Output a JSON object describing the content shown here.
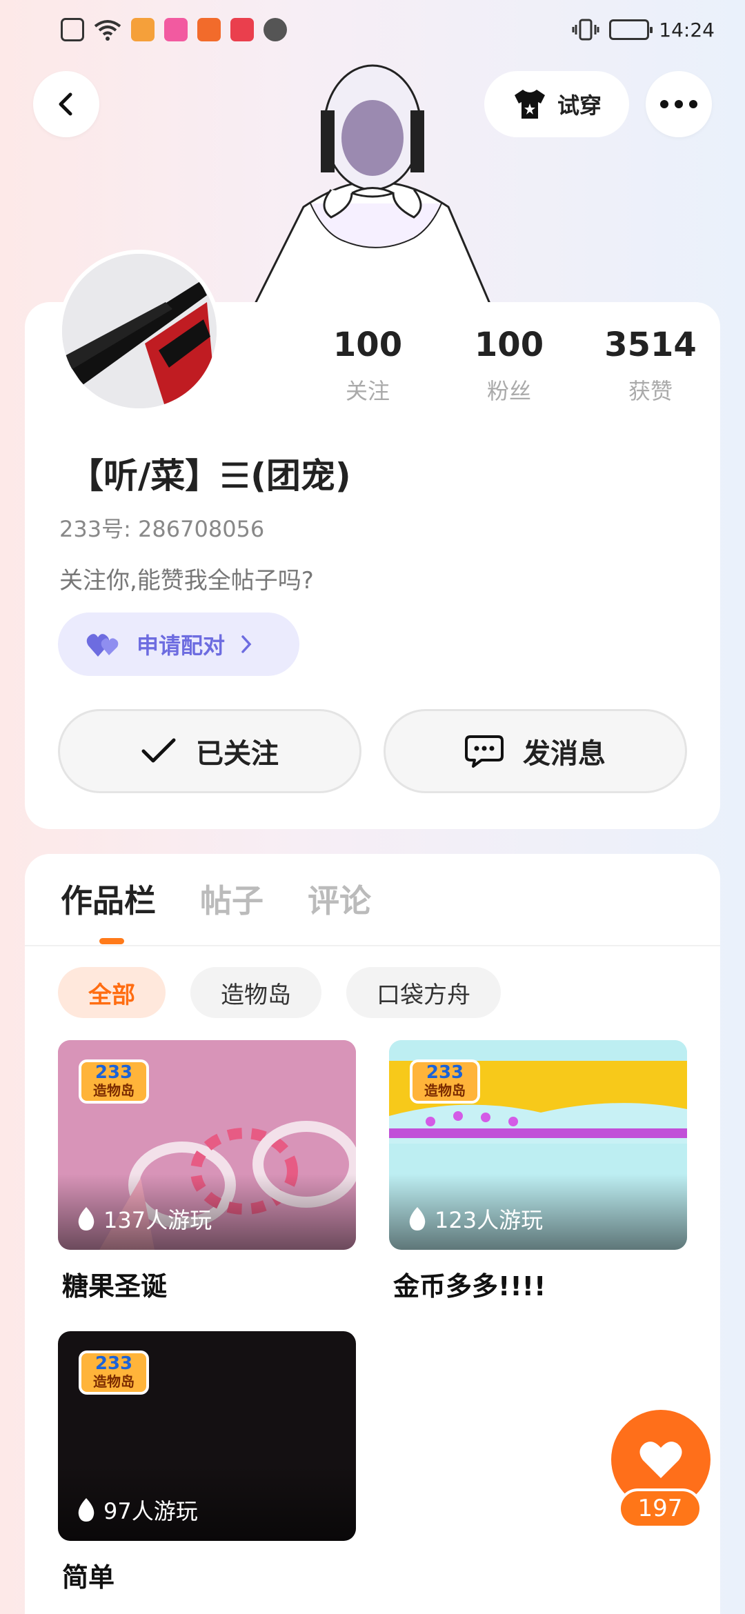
{
  "status_bar": {
    "time": "14:24"
  },
  "header": {
    "try_on_label": "试穿"
  },
  "profile": {
    "stats": [
      {
        "value": "100",
        "label": "关注"
      },
      {
        "value": "100",
        "label": "粉丝"
      },
      {
        "value": "3514",
        "label": "获赞"
      }
    ],
    "nickname": "【听/菜】☰(团宠)",
    "uid": "233号: 286708056",
    "bio": "关注你,能赞我全帖子吗?",
    "pair_button": "申请配对",
    "follow_button": "已关注",
    "message_button": "发消息"
  },
  "tabs": [
    {
      "label": "作品栏",
      "active": true
    },
    {
      "label": "帖子",
      "active": false
    },
    {
      "label": "评论",
      "active": false
    }
  ],
  "filters": [
    {
      "label": "全部",
      "active": true
    },
    {
      "label": "造物岛",
      "active": false
    },
    {
      "label": "口袋方舟",
      "active": false
    }
  ],
  "games": [
    {
      "title": "糖果圣诞",
      "plays": "137人游玩"
    },
    {
      "title": "金币多多!!!!",
      "plays": "123人游玩"
    },
    {
      "title": "简单",
      "plays": "97人游玩"
    }
  ],
  "game_logo": {
    "top": "233",
    "bottom": "造物岛"
  },
  "like_fab": {
    "count": "197"
  },
  "colors": {
    "accent": "#ff6f1a",
    "pair": "#6d6ce0"
  }
}
